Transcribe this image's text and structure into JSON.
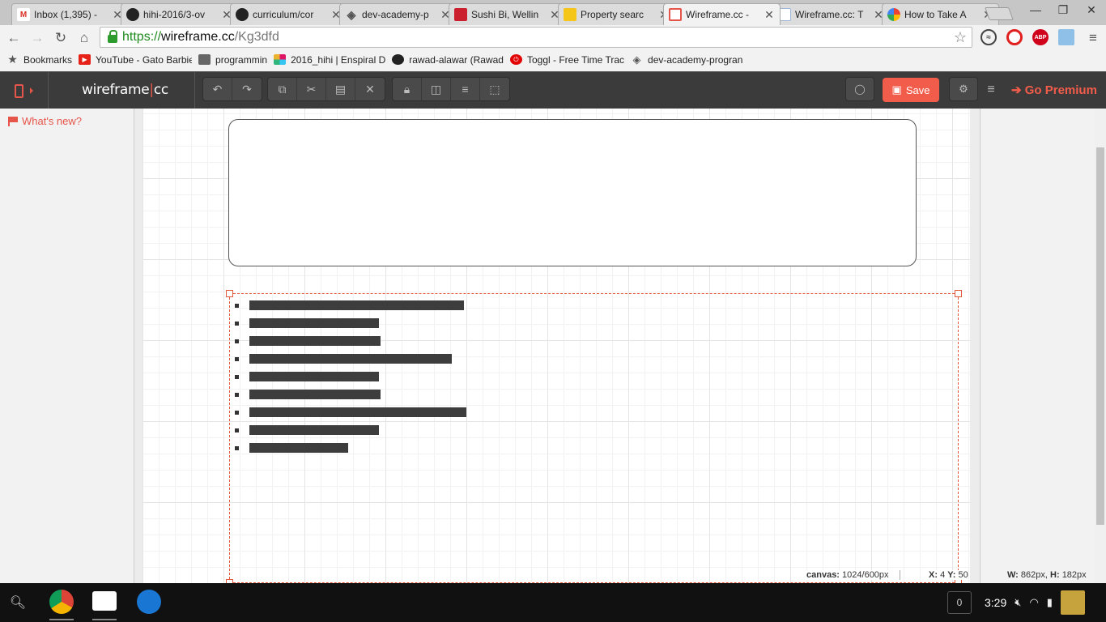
{
  "browser": {
    "tabs": [
      {
        "title": "Inbox (1,395) -",
        "favicon": "gmail-icon",
        "color": "#d93025",
        "active": false
      },
      {
        "title": "hihi-2016/3-ov",
        "favicon": "github-icon",
        "color": "#222222",
        "active": false
      },
      {
        "title": "curriculum/cor",
        "favicon": "github-icon",
        "color": "#222222",
        "active": false
      },
      {
        "title": "dev-academy-p",
        "favicon": "dev-academy-icon",
        "color": "#555555",
        "active": false
      },
      {
        "title": "Sushi Bi, Wellin",
        "favicon": "zomato-icon",
        "color": "#cb202d",
        "active": false
      },
      {
        "title": "Property searc",
        "favicon": "property-icon",
        "color": "#2a6fb0",
        "active": false
      },
      {
        "title": "Wireframe.cc -",
        "favicon": "wireframe-icon",
        "color": "#e6554a",
        "active": true
      },
      {
        "title": "Wireframe.cc: T",
        "favicon": "document-icon",
        "color": "#9fb7d6",
        "active": false
      },
      {
        "title": "How to Take A",
        "favicon": "google-icon",
        "color": "#4285f4",
        "active": false
      }
    ],
    "url": {
      "scheme": "https://",
      "host": "wireframe.cc",
      "path": "/Kg3dfd"
    },
    "bookmarks": [
      {
        "label": "Bookmarks",
        "icon": "star-icon",
        "color": "#555555"
      },
      {
        "label": "YouTube - Gato Barbie",
        "icon": "youtube-icon",
        "color": "#e62117"
      },
      {
        "label": "programmin",
        "icon": "folder-icon",
        "color": "#666666"
      },
      {
        "label": "2016_hihi | Enspiral D",
        "icon": "slack-icon",
        "color": "#e01563"
      },
      {
        "label": "rawad-alawar (Rawad",
        "icon": "github-icon",
        "color": "#222222"
      },
      {
        "label": "Toggl - Free Time Trac",
        "icon": "toggl-icon",
        "color": "#e20505"
      },
      {
        "label": "dev-academy-progran",
        "icon": "dev-academy-icon",
        "color": "#555555"
      }
    ],
    "extensions": [
      {
        "name": "sync-icon",
        "label": "",
        "color": "#444444"
      },
      {
        "name": "opera-icon",
        "label": "",
        "color": "#e01f1f"
      },
      {
        "name": "adblock-icon",
        "label": "ABP",
        "color": "#d0021b"
      },
      {
        "name": "picture-icon",
        "label": "",
        "color": "#8fc1e8"
      }
    ]
  },
  "app": {
    "logo_left": "wireframe",
    "logo_sep": "|",
    "logo_right": "cc",
    "save_label": "Save",
    "premium_label": "Go Premium",
    "whats_new": "What's new?",
    "accent": "#f25c4a",
    "status": {
      "canvas_label": "canvas:",
      "canvas_value": "1024/600px",
      "x_label": "X:",
      "x_value": "4",
      "y_label": "Y:",
      "y_value": "50",
      "w_label": "W:",
      "w_value": "862px,",
      "h_label": "H:",
      "h_value": "182px"
    }
  },
  "shelf": {
    "clock": "3:29",
    "notifications": "0"
  }
}
